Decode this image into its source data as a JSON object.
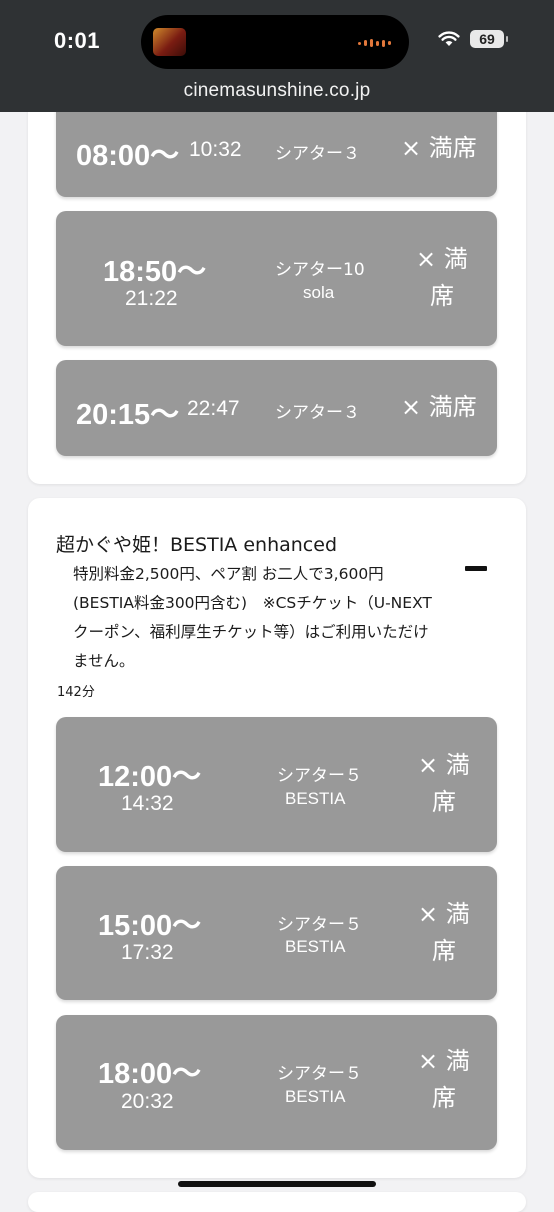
{
  "status_bar": {
    "time": "0:01",
    "battery": "69",
    "url": "cinemasunshine.co.jp"
  },
  "card1": {
    "showtimes": [
      {
        "start": "08:00〜",
        "end": "10:32",
        "theater": "シアター３",
        "screen": "",
        "status": "× 満席"
      },
      {
        "start": "18:50〜",
        "end": "21:22",
        "theater": "シアター10",
        "screen": "sola",
        "status_line1": "× 満",
        "status_line2": "席"
      },
      {
        "start": "20:15〜",
        "end": "22:47",
        "theater": "シアター３",
        "screen": "",
        "status": "× 満席"
      }
    ]
  },
  "card2": {
    "title": "超かぐや姫！BESTIA enhanced",
    "note": "特別料金2,500円、ペア割 お二人で3,600円(BESTIA料金300円含む)　※CSチケット（U-NEXTクーポン、福利厚生チケット等）はご利用いただけません。",
    "runtime": "142分",
    "showtimes": [
      {
        "start": "12:00〜",
        "end": "14:32",
        "theater": "シアター５",
        "screen": "BESTIA",
        "status_line1": "× 満",
        "status_line2": "席"
      },
      {
        "start": "15:00〜",
        "end": "17:32",
        "theater": "シアター５",
        "screen": "BESTIA",
        "status_line1": "× 満",
        "status_line2": "席"
      },
      {
        "start": "18:00〜",
        "end": "20:32",
        "theater": "シアター５",
        "screen": "BESTIA",
        "status_line1": "× 満",
        "status_line2": "席"
      }
    ]
  },
  "colors": {
    "slot_bg": "#999999",
    "card_bg": "#ffffff",
    "page_bg": "#f2f2f4",
    "topbar_bg": "#2f3234"
  }
}
